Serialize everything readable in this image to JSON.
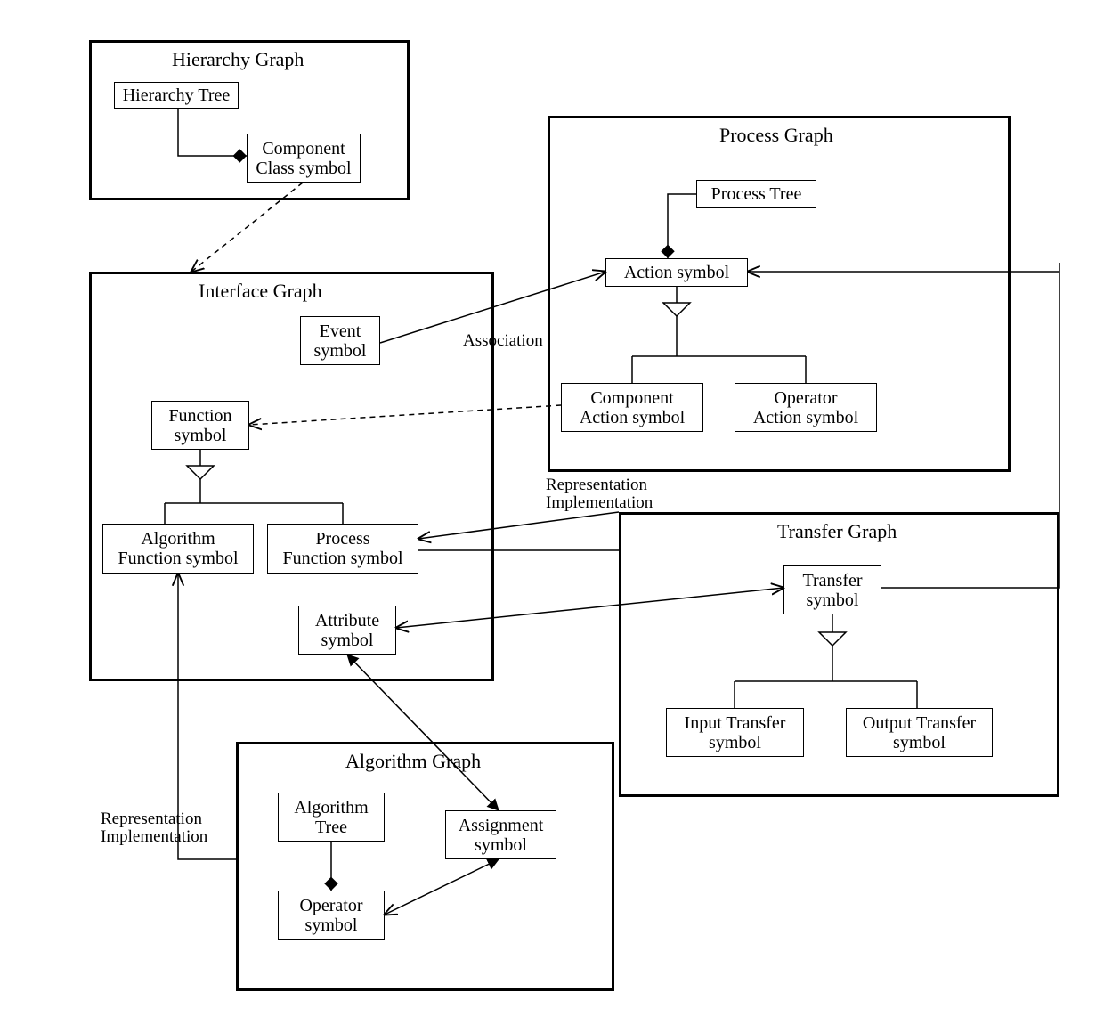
{
  "groups": {
    "hierarchy": {
      "title": "Hierarchy Graph"
    },
    "interface": {
      "title": "Interface Graph"
    },
    "process": {
      "title": "Process Graph"
    },
    "transfer": {
      "title": "Transfer Graph"
    },
    "algorithm": {
      "title": "Algorithm Graph"
    }
  },
  "boxes": {
    "hierarchyTree": "Hierarchy Tree",
    "componentClass": "Component\nClass symbol",
    "eventSymbol": "Event\nsymbol",
    "functionSymbol": "Function\nsymbol",
    "algorithmFunction": "Algorithm\nFunction symbol",
    "processFunction": "Process\nFunction symbol",
    "attributeSymbol": "Attribute\nsymbol",
    "processTree": "Process Tree",
    "actionSymbol": "Action symbol",
    "componentAction": "Component\nAction symbol",
    "operatorAction": "Operator\nAction symbol",
    "transferSymbol": "Transfer\nsymbol",
    "inputTransfer": "Input Transfer\nsymbol",
    "outputTransfer": "Output Transfer\nsymbol",
    "algorithmTree": "Algorithm\nTree",
    "operatorSymbol": "Operator\nsymbol",
    "assignmentSymbol": "Assignment\nsymbol"
  },
  "labels": {
    "association": "Association",
    "repImpl1": "Representation\nImplementation",
    "repImpl2": "Representation\nImplementation"
  }
}
